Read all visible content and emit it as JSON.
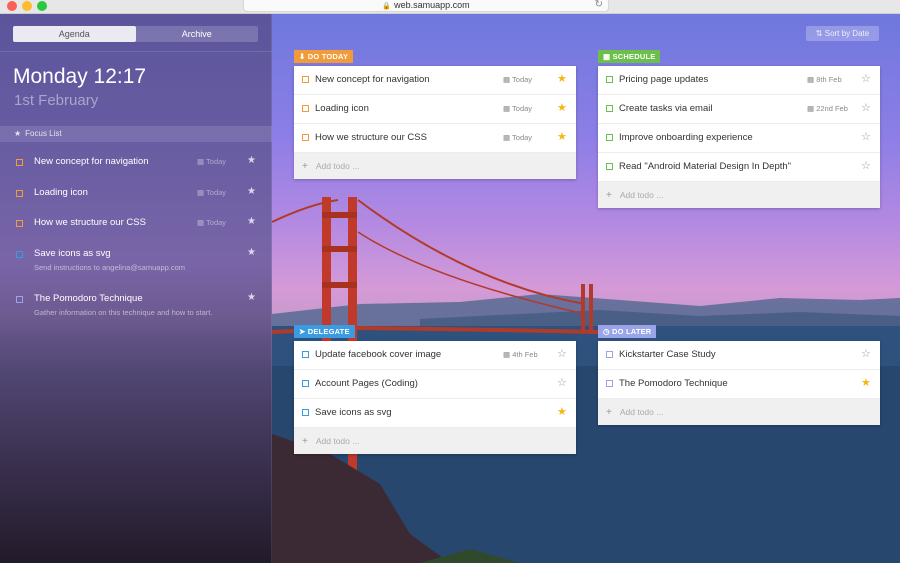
{
  "browser": {
    "url": "web.samuapp.com"
  },
  "sidebar": {
    "tabs": [
      "Agenda",
      "Archive"
    ],
    "active_tab": "Agenda",
    "clock": "Monday 12:17",
    "date": "1st February",
    "focus_label": "Focus List",
    "items": [
      {
        "title": "New concept for navigation",
        "due": "Today",
        "color": "#f29b3a"
      },
      {
        "title": "Loading icon",
        "due": "Today",
        "color": "#f29b3a"
      },
      {
        "title": "How we structure our CSS",
        "due": "Today",
        "color": "#f29b3a"
      },
      {
        "title": "Save icons as svg",
        "sub": "Send instructions to angelina@samuapp.com",
        "color": "#3b9be0"
      },
      {
        "title": "The Pomodoro Technique",
        "sub": "Gather information on this technique and how to start.",
        "color": "#9aa4e8"
      }
    ]
  },
  "sort_button": "Sort by Date",
  "panels": {
    "do_today": {
      "label": "DO TODAY",
      "icon": "download-arrow-icon",
      "color": "#f29b3a",
      "add_label": "Add todo ...",
      "rows": [
        {
          "title": "New concept for navigation",
          "due": "Today",
          "starred": true
        },
        {
          "title": "Loading icon",
          "due": "Today",
          "starred": true
        },
        {
          "title": "How we structure our CSS",
          "due": "Today",
          "starred": true
        }
      ]
    },
    "schedule": {
      "label": "SCHEDULE",
      "icon": "calendar-icon",
      "color": "#6cc04a",
      "add_label": "Add todo ...",
      "rows": [
        {
          "title": "Pricing page updates",
          "due": "8th Feb",
          "starred": false
        },
        {
          "title": "Create tasks via email",
          "due": "22nd Feb",
          "starred": false
        },
        {
          "title": "Improve onboarding experience",
          "due": "",
          "starred": false
        },
        {
          "title": "Read \"Android Material Design In Depth\"",
          "due": "",
          "starred": false
        }
      ]
    },
    "delegate": {
      "label": "DELEGATE",
      "icon": "paper-plane-icon",
      "color": "#3b9be0",
      "add_label": "Add todo ...",
      "rows": [
        {
          "title": "Update facebook cover image",
          "due": "4th Feb",
          "starred": false
        },
        {
          "title": "Account Pages (Coding)",
          "due": "",
          "starred": false
        },
        {
          "title": "Save icons as svg",
          "due": "",
          "starred": true
        }
      ]
    },
    "do_later": {
      "label": "DO LATER",
      "icon": "clock-icon",
      "color": "#9aa4e8",
      "add_label": "Add todo ...",
      "rows": [
        {
          "title": "Kickstarter Case Study",
          "due": "",
          "starred": false
        },
        {
          "title": "The Pomodoro Technique",
          "due": "",
          "starred": true
        }
      ]
    }
  }
}
